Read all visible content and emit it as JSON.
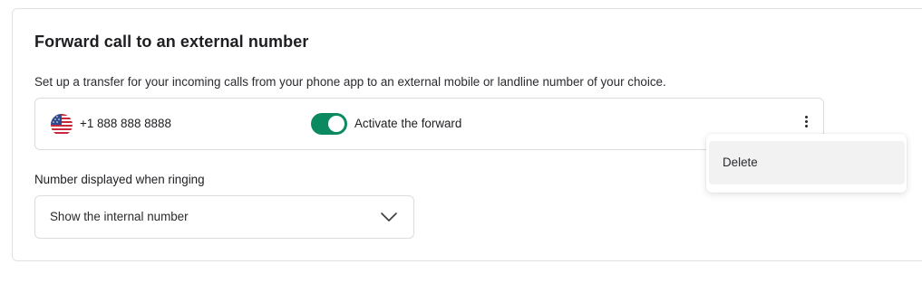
{
  "section": {
    "title": "Forward call to an external number",
    "description": "Set up a transfer for your incoming calls from your phone app to an external mobile or landline number of your choice."
  },
  "forward": {
    "flag_icon": "us-flag-icon",
    "phone_number": "+1 888 888 8888",
    "toggle_on": true,
    "toggle_color": "#0b8a62",
    "toggle_label": "Activate the forward",
    "more_icon": "kebab-menu-icon"
  },
  "caller_id": {
    "label": "Number displayed when ringing",
    "selected": "Show the internal number",
    "chevron_icon": "chevron-down-icon"
  },
  "menu": {
    "items": [
      {
        "label": "Delete"
      }
    ]
  }
}
